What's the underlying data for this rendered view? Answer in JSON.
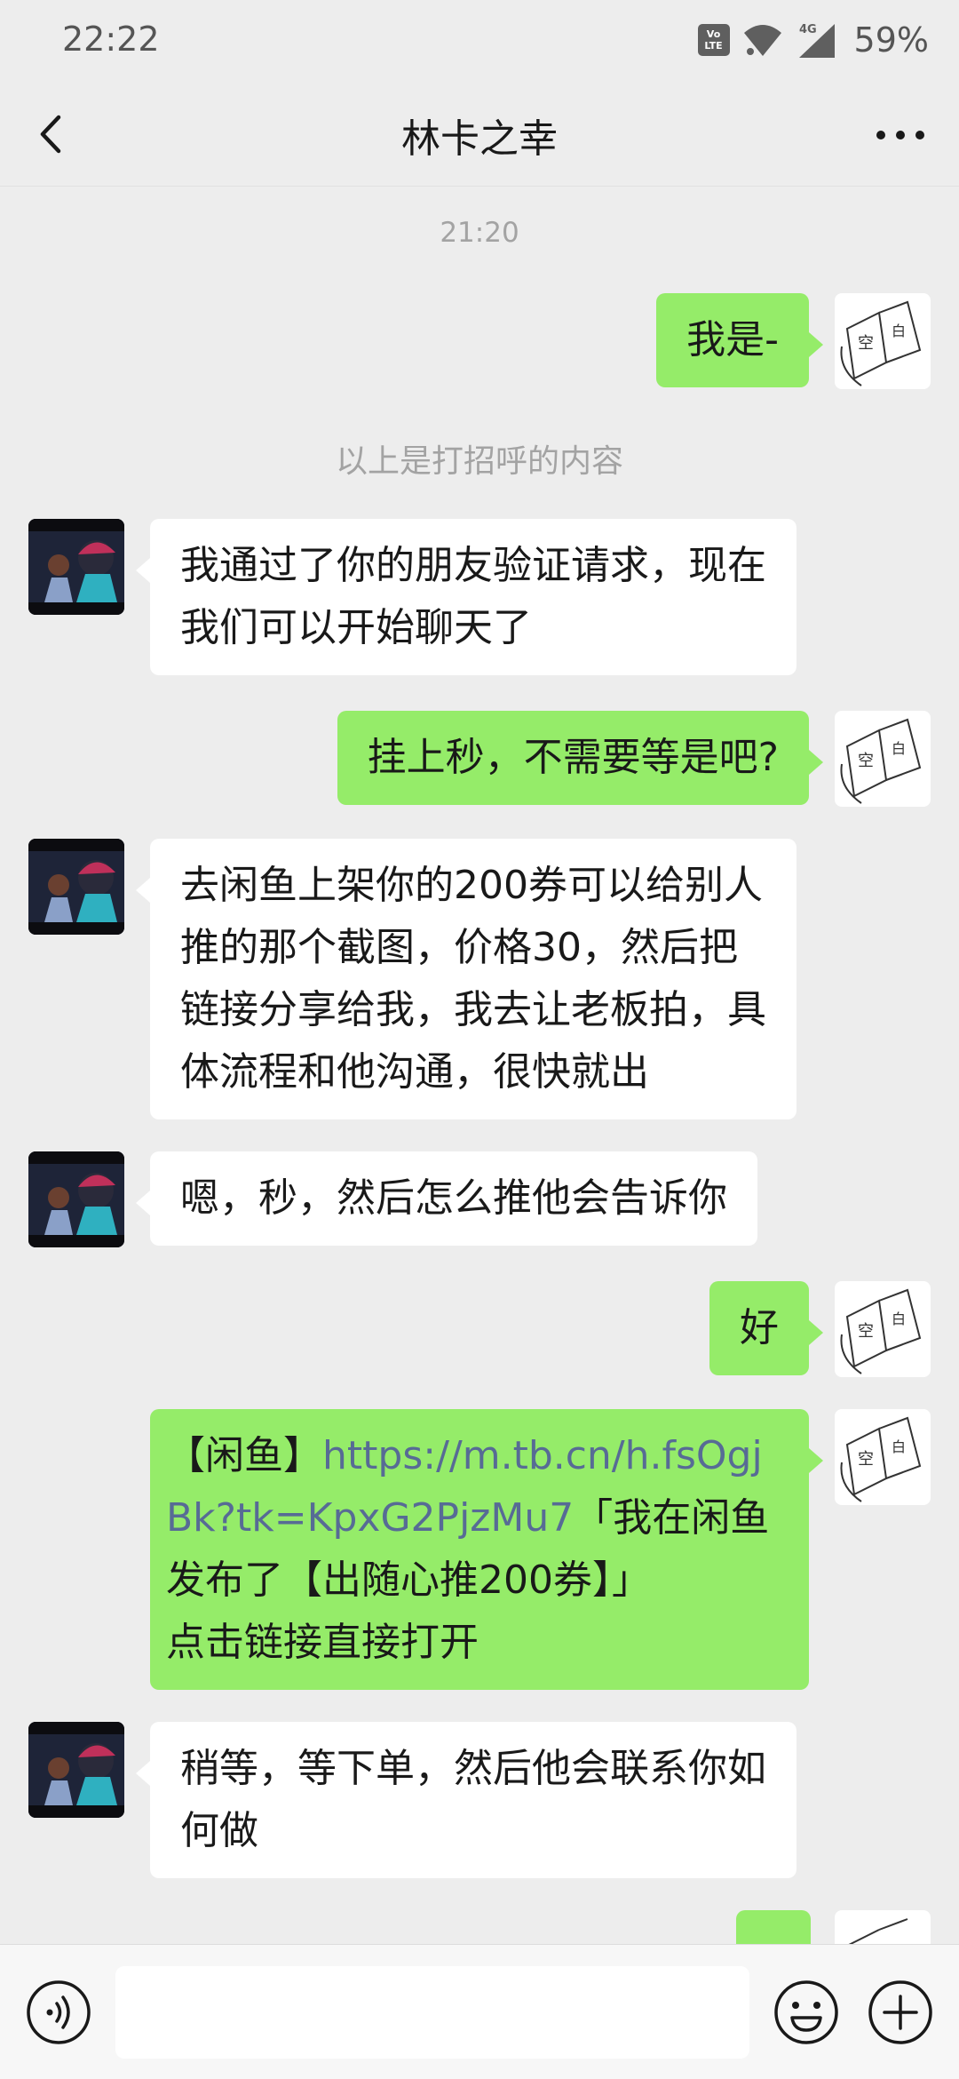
{
  "status_bar": {
    "time": "22:22",
    "volte_top": "Vo",
    "volte_bottom": "LTE",
    "network_label": "4G",
    "battery": "59%"
  },
  "header": {
    "title": "林卡之幸"
  },
  "timestamp": "21:20",
  "system_notice": "以上是打招呼的内容",
  "messages": [
    {
      "from": "me",
      "text": "我是-"
    },
    {
      "from": "contact",
      "text": "我通过了你的朋友验证请求，现在\n我们可以开始聊天了"
    },
    {
      "from": "me",
      "text": "挂上秒，不需要等是吧?"
    },
    {
      "from": "contact",
      "text": "去闲鱼上架你的200券可以给别人\n推的那个截图，价格30，然后把\n链接分享给我，我去让老板拍，具\n体流程和他沟通，很快就出"
    },
    {
      "from": "contact",
      "text": "嗯，秒，然后怎么推他会告诉你"
    },
    {
      "from": "me",
      "text": "好"
    },
    {
      "from": "me",
      "prefix": "【闲鱼】",
      "link": "https://m.tb.cn/h.fsOgjBk?tk=KpxG2PjzMu7",
      "suffix": "「我在闲鱼发布了【出随心推200券】」\n点击链接直接打开"
    },
    {
      "from": "contact",
      "text": "稍等，等下单，然后他会联系你如\n何做"
    }
  ],
  "my_avatar_text": [
    "空",
    "白"
  ],
  "input": {
    "placeholder": ""
  },
  "colors": {
    "background": "#ededed",
    "sent_bubble": "#95ec69",
    "received_bubble": "#ffffff",
    "link": "#576b95"
  }
}
